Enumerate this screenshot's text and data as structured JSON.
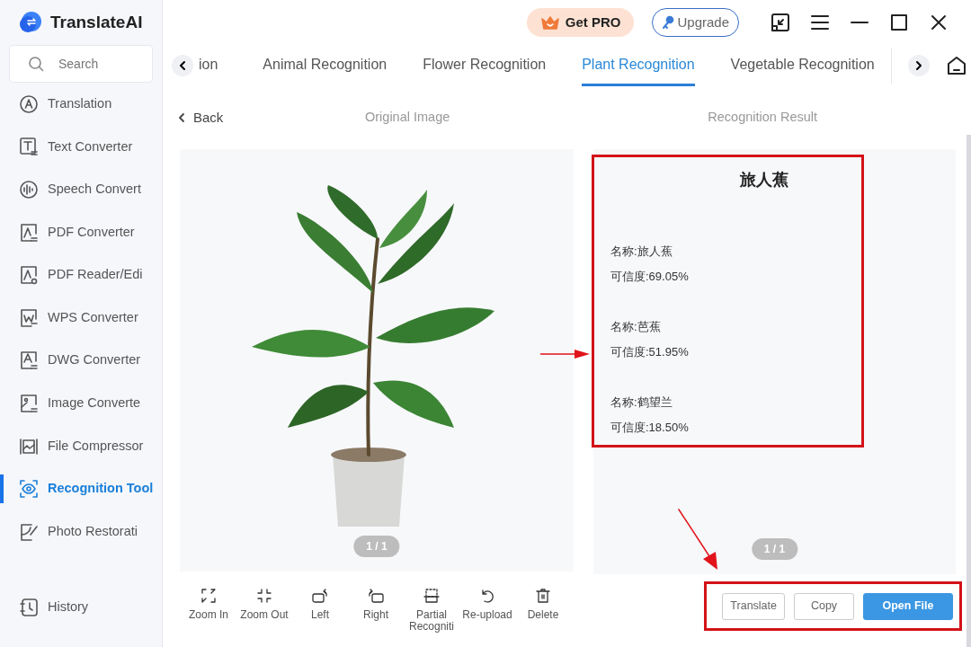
{
  "app": {
    "name": "TranslateAI"
  },
  "header": {
    "pro_button": "Get PRO",
    "upgrade_button": "Upgrade"
  },
  "sidebar": {
    "search": {
      "placeholder": "Search"
    },
    "items": [
      {
        "label": "Translation",
        "selected": false
      },
      {
        "label": "Text Converter",
        "selected": false
      },
      {
        "label": "Speech Convert",
        "selected": false
      },
      {
        "label": "PDF Converter",
        "selected": false
      },
      {
        "label": "PDF Reader/Edi",
        "selected": false
      },
      {
        "label": "WPS Converter",
        "selected": false
      },
      {
        "label": "DWG Converter",
        "selected": false
      },
      {
        "label": "Image Converte",
        "selected": false
      },
      {
        "label": "File Compressor",
        "selected": false
      },
      {
        "label": "Recognition Tool",
        "selected": true
      },
      {
        "label": "Photo Restorati",
        "selected": false
      }
    ],
    "history": "History"
  },
  "tabs": [
    {
      "label": "ion",
      "selected": false
    },
    {
      "label": "Animal Recognition",
      "selected": false
    },
    {
      "label": "Flower Recognition",
      "selected": false
    },
    {
      "label": "Plant Recognition",
      "selected": true
    },
    {
      "label": "Vegetable Recognition",
      "selected": false
    }
  ],
  "back": "Back",
  "original": {
    "title": "Original Image",
    "page": "1 / 1"
  },
  "result": {
    "title": "Recognition Result",
    "heading": "旅人蕉",
    "page": "1 / 1",
    "results": [
      {
        "name": "名称:旅人蕉",
        "confidence": "可信度:69.05%"
      },
      {
        "name": "名称:芭蕉",
        "confidence": "可信度:51.95%"
      },
      {
        "name": "名称:鹤望兰",
        "confidence": "可信度:18.50%"
      }
    ]
  },
  "tools": [
    {
      "label": "Zoom In",
      "kind": "zoom-in"
    },
    {
      "label": "Zoom Out",
      "kind": "zoom-out"
    },
    {
      "label": "Left",
      "kind": "rotate-left"
    },
    {
      "label": "Right",
      "kind": "rotate-right"
    },
    {
      "label": "Partial Recogniti",
      "kind": "partial"
    },
    {
      "label": "Re-upload",
      "kind": "reupload"
    },
    {
      "label": "Delete",
      "kind": "delete"
    }
  ],
  "actions": [
    {
      "label": "Translate",
      "kind": "outline"
    },
    {
      "label": "Copy",
      "kind": "outline"
    },
    {
      "label": "Open File",
      "kind": "primary"
    }
  ]
}
